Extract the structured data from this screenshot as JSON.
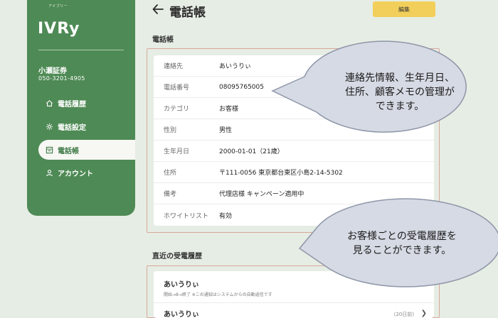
{
  "sidebar": {
    "logo_ruby": "アイブリー",
    "logo": "IVRy",
    "company": "小瀬証券",
    "phone": "050-3201-4905",
    "items": [
      {
        "label": "電話履歴",
        "icon": "home-icon"
      },
      {
        "label": "電話設定",
        "icon": "gear-icon"
      },
      {
        "label": "電話帳",
        "icon": "phonebook-icon",
        "active": true
      },
      {
        "label": "アカウント",
        "icon": "person-icon"
      }
    ]
  },
  "header": {
    "title": "電話帳",
    "edit_label": "編集"
  },
  "contact": {
    "section_title": "電話帳",
    "rows": [
      {
        "label": "連絡先",
        "value": "あいうりぃ"
      },
      {
        "label": "電話番号",
        "value": "08095765005"
      },
      {
        "label": "カテゴリ",
        "value": "お客様"
      },
      {
        "label": "性別",
        "value": "男性"
      },
      {
        "label": "生年月日",
        "value": "2000-01-01（21歳）"
      },
      {
        "label": "住所",
        "value": "〒111-0056 東京都台東区小島2-14-5302"
      },
      {
        "label": "備考",
        "value": "代理店様 キャンペーン適用中"
      },
      {
        "label": "ホワイトリスト",
        "value": "有効"
      }
    ]
  },
  "history": {
    "section_title": "直近の受電履歴",
    "items": [
      {
        "name": "あいうりぃ",
        "sub": "開始→8→終了 ※この通知はシステムからの自動返信です"
      },
      {
        "name": "あいうりぃ",
        "count": "(20日前)"
      }
    ]
  },
  "bubbles": {
    "top": [
      "連絡先情報、生年月日、",
      "住所、顧客メモの管理が",
      "できます。"
    ],
    "bottom": [
      "お客様ごとの受電履歴を",
      "見ることができます。"
    ]
  },
  "colors": {
    "sidebar": "#4e8a55",
    "edit_button": "#f2cf5a",
    "background": "#e6ede4",
    "bubble": "#d6dae4",
    "outline": "#d9a79b"
  }
}
